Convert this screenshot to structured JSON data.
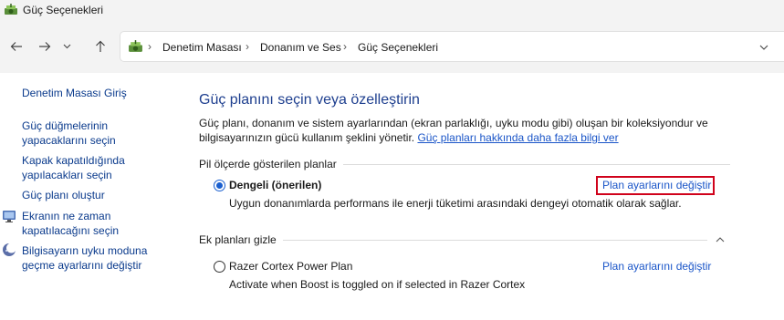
{
  "window": {
    "title": "Güç Seçenekleri",
    "app_icon": "power-options-icon"
  },
  "nav": {
    "back_icon": "arrow-left-icon",
    "forward_icon": "arrow-right-icon",
    "recent_icon": "chevron-down-icon",
    "up_icon": "arrow-up-icon"
  },
  "address": {
    "icon": "control-panel-icon",
    "separator": "›",
    "crumbs": [
      "Denetim Masası",
      "Donanım ve Ses",
      "Güç Seçenekleri"
    ],
    "dropdown_icon": "chevron-down-icon"
  },
  "sidebar": {
    "home": "Denetim Masası Giriş",
    "items": [
      {
        "label": "Güç düğmelerinin yapacaklarını seçin",
        "lines": [
          "Güç düğmelerinin",
          "yapacaklarını seçin"
        ]
      },
      {
        "label": "Kapak kapatıldığında yapılacakları seçin",
        "lines": [
          "Kapak kapatıldığında",
          "yapılacakları seçin"
        ]
      },
      {
        "label": "Güç planı oluştur",
        "lines": [
          "Güç planı oluştur"
        ]
      },
      {
        "label": "Ekranın ne zaman kapatılacağını seçin",
        "lines": [
          "Ekranın ne zaman",
          "kapatılacağını seçin"
        ],
        "icon": "display-icon"
      },
      {
        "label": "Bilgisayarın uyku moduna geçme ayarlarını değiştir",
        "lines": [
          "Bilgisayarın uyku moduna",
          "geçme ayarlarını değiştir"
        ],
        "icon": "sleep-moon-icon"
      }
    ]
  },
  "main": {
    "title": "Güç planını seçin veya özelleştirin",
    "description": "Güç planı, donanım ve sistem ayarlarından (ekran parlaklığı, uyku modu gibi) oluşan bir koleksiyondur ve bilgisayarınızın gücü kullanım şeklini yönetir.",
    "description_line1": "Güç planı, donanım ve sistem ayarlarından (ekran parlaklığı, uyku modu gibi) oluşan bir koleksiyondur ve",
    "description_line2": "bilgisayarınızın gücü kullanım şeklini yönetir.",
    "learn_more_link": "Güç planları hakkında daha fazla bilgi ver",
    "battery_group": {
      "label": "Pil ölçerde gösterilen planlar",
      "plans": [
        {
          "name": "Dengeli (önerilen)",
          "selected": true,
          "description": "Uygun donanımlarda performans ile enerji tüketimi arasındaki dengeyi otomatik olarak sağlar.",
          "link": "Plan ayarlarını değiştir"
        }
      ]
    },
    "extra_group": {
      "label": "Ek planları gizle",
      "collapse_icon": "chevron-up-icon",
      "plans": [
        {
          "name": "Razer Cortex Power Plan",
          "selected": false,
          "description": "Activate when Boost is toggled on if selected in Razer Cortex",
          "link": "Plan ayarlarını değiştir"
        }
      ]
    },
    "highlight_color": "#d0021b",
    "link_color": "#1a55c8",
    "title_color": "#1e3f8f"
  }
}
